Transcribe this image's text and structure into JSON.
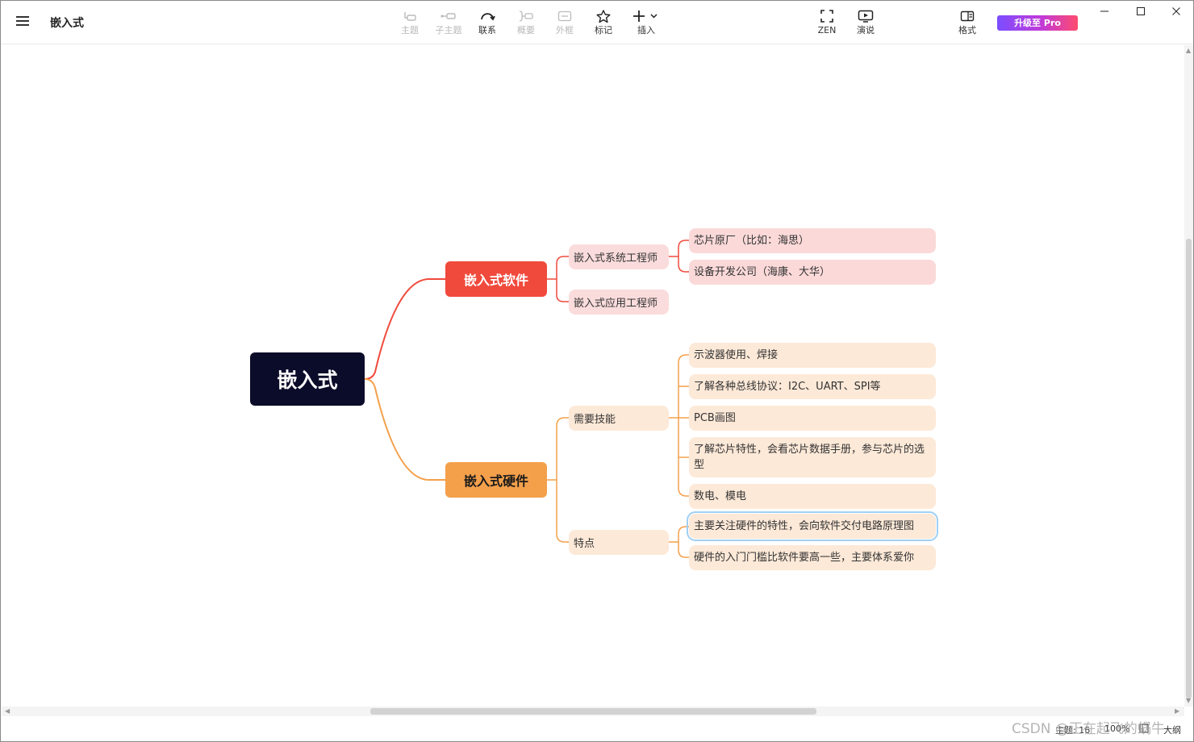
{
  "app": {
    "doc_title": "嵌入式"
  },
  "toolbar": {
    "items": [
      {
        "label": "主题",
        "icon": "topic-icon",
        "enabled": false
      },
      {
        "label": "子主题",
        "icon": "subtopic-icon",
        "enabled": false
      },
      {
        "label": "联系",
        "icon": "relationship-icon",
        "enabled": true
      },
      {
        "label": "概要",
        "icon": "summary-icon",
        "enabled": false
      },
      {
        "label": "外框",
        "icon": "boundary-icon",
        "enabled": false
      },
      {
        "label": "标记",
        "icon": "star-icon",
        "enabled": true
      },
      {
        "label": "插入",
        "icon": "plus-icon",
        "enabled": true
      },
      {
        "label": "ZEN",
        "icon": "fullscreen-icon",
        "enabled": true
      },
      {
        "label": "演说",
        "icon": "present-icon",
        "enabled": true
      },
      {
        "label": "格式",
        "icon": "format-panel-icon",
        "enabled": true
      }
    ],
    "pro_label": "升级至 Pro"
  },
  "mindmap": {
    "root": "嵌入式",
    "branches": [
      {
        "label": "嵌入式软件",
        "color": "#f04a3c",
        "children": [
          {
            "label": "嵌入式系统工程师",
            "children": [
              "芯片原厂（比如：海思）",
              "设备开发公司（海康、大华）"
            ]
          },
          {
            "label": "嵌入式应用工程师",
            "children": []
          }
        ]
      },
      {
        "label": "嵌入式硬件",
        "color": "#f4a04b",
        "children": [
          {
            "label": "需要技能",
            "children": [
              "示波器使用、焊接",
              "了解各种总线协议：I2C、UART、SPI等",
              "PCB画图",
              "了解芯片特性，会看芯片数据手册，参与芯片的选型",
              "数电、模电"
            ]
          },
          {
            "label": "特点",
            "children": [
              "主要关注硬件的特性，会向软件交付电路原理图",
              "硬件的入门门槛比软件要高一些，主要体系爱你"
            ]
          }
        ]
      }
    ]
  },
  "statusbar": {
    "topics": "主题: 16",
    "zoom": "100%",
    "outline": "大纲"
  },
  "watermark": "CSDN @正在起飞的蜗牛"
}
